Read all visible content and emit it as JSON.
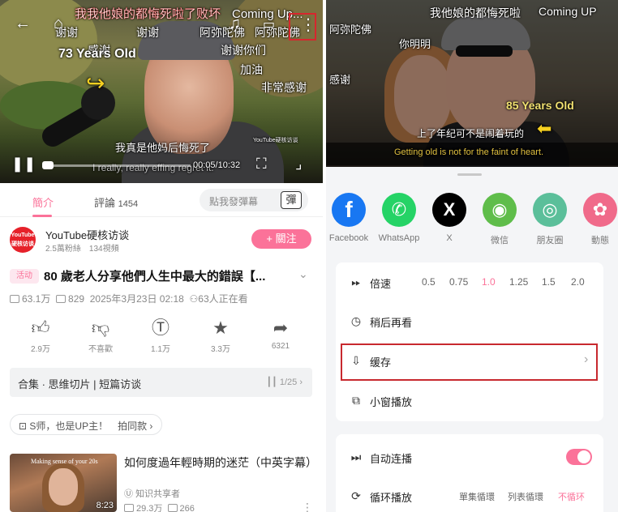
{
  "left": {
    "video": {
      "subtitle_top": "我我他娘的都悔死啦了败坏",
      "channel_watermark": "Coming Up...",
      "danmaku": [
        "谢谢",
        "谢谢",
        "阿弥陀佛",
        "阿弥陀佛",
        "感谢",
        "谢谢你们",
        "加油",
        "非常感谢"
      ],
      "age_label": "73 Years Old",
      "subtitle_cn": "我真是他妈后悔死了",
      "subtitle_en": "I really, really effing regret it.",
      "watermark_small": "YouTube硬核访谈",
      "time": "00:05/10:32",
      "progress": 0.008
    },
    "tabs": {
      "intro": "簡介",
      "comments": "評論",
      "comment_count": "1454",
      "danmaku_placeholder": "點我發彈幕",
      "danmaku_btn": "彈"
    },
    "uploader": {
      "avatar_text": "YouTube 硬核访谈",
      "name": "YouTube硬核访谈",
      "meta": "2.5萬粉絲　134視頻",
      "follow": "+ 關注"
    },
    "video_info": {
      "tag": "活动",
      "title": "80 歲老人分享他們人生中最大的錯誤【...",
      "views": "63.1万",
      "danmaku_count": "829",
      "date": "2025年3月23日 02:18",
      "watching": "63人正在看"
    },
    "actions": [
      {
        "icon": "thumbs-up-icon",
        "label": "2.9万"
      },
      {
        "icon": "thumbs-down-icon",
        "label": "不喜歡"
      },
      {
        "icon": "coin-icon",
        "label": "1.1万"
      },
      {
        "icon": "star-icon",
        "label": "3.3万"
      },
      {
        "icon": "share-icon",
        "label": "6321"
      }
    ],
    "collection": {
      "label": "合集 · 思维切片 | 短篇访谈",
      "count": "1/25"
    },
    "promo": "S师，也是UP主！　拍同款",
    "recommended": {
      "thumb_title": "Making sense of your 20s",
      "duration": "8:23",
      "title": "如何度過年輕時期的迷茫（中英字幕）",
      "up": "知识共享者",
      "views": "29.3万",
      "danmaku": "266"
    }
  },
  "right": {
    "video": {
      "subtitle_top": "我他娘的都悔死啦",
      "watermark": "Coming UP",
      "danmaku": [
        "你明明",
        "阿弥陀佛",
        "感谢"
      ],
      "age_label": "85 Years Old",
      "subtitle_cn": "上了年纪可不是闹着玩的",
      "subtitle_en": "Getting old is not for the faint of heart."
    },
    "share_targets": [
      {
        "name": "Facebook",
        "color": "#1877f2",
        "glyph": "f"
      },
      {
        "name": "WhatsApp",
        "color": "#25d366",
        "glyph": "✆"
      },
      {
        "name": "X",
        "color": "#000000",
        "glyph": "X"
      },
      {
        "name": "微信",
        "color": "#5fbd4a",
        "glyph": "◉"
      },
      {
        "name": "朋友圈",
        "color": "#5bbf9a",
        "glyph": "◎"
      },
      {
        "name": "動態",
        "color": "#f06a8a",
        "glyph": "✿"
      }
    ],
    "menu": {
      "speed_label": "倍速",
      "speeds": [
        "0.5",
        "0.75",
        "1.0",
        "1.25",
        "1.5",
        "2.0"
      ],
      "selected_speed": "1.0",
      "watch_later": "稍后再看",
      "cache": "缓存",
      "mini_player": "小窗播放",
      "autoplay": "自动连播",
      "autoplay_on": true,
      "loop_label": "循环播放",
      "loop_options": [
        "單集循環",
        "列表循環",
        "不循环"
      ],
      "selected_loop": "不循环"
    }
  },
  "colors": {
    "accent": "#fb7299",
    "highlight_box": "#c8292f"
  }
}
